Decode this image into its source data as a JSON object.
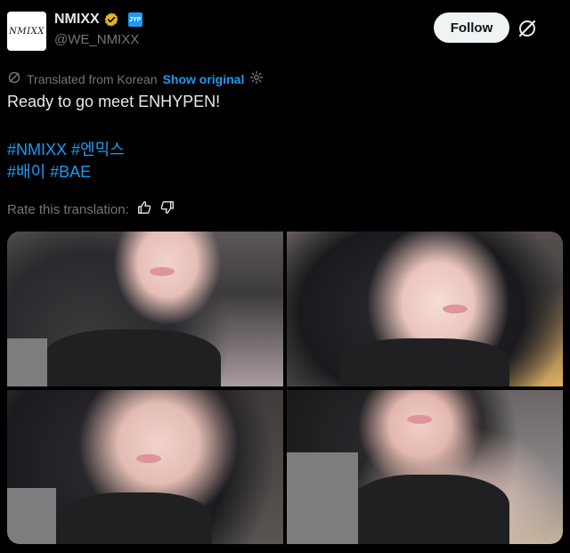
{
  "account": {
    "avatar_text": "NMIXX",
    "display_name": "NMIXX",
    "handle": "@WE_NMIXX",
    "verified_color": "#e2b719",
    "affiliate_badge_text": "JYP"
  },
  "follow_label": "Follow",
  "translation": {
    "notice": "Translated from Korean",
    "show_original": "Show original"
  },
  "tweet": {
    "text": "Ready to go meet ENHYPEN!",
    "hashtags_line1": [
      "#NMIXX",
      "#엔믹스"
    ],
    "hashtags_line2": [
      "#배이",
      "#BAE"
    ]
  },
  "rate_label": "Rate this translation:",
  "media": {
    "count": 4,
    "photos": [
      "photo-1",
      "photo-2",
      "photo-3",
      "photo-4"
    ]
  },
  "icons": [
    "verified-icon",
    "x-grok-icon",
    "translate-icon",
    "settings-icon",
    "thumbs-up-icon",
    "thumbs-down-icon"
  ],
  "colors": {
    "accent": "#1d9bf0",
    "muted": "#71767b",
    "text": "#e7e9ea",
    "background": "#000000"
  }
}
